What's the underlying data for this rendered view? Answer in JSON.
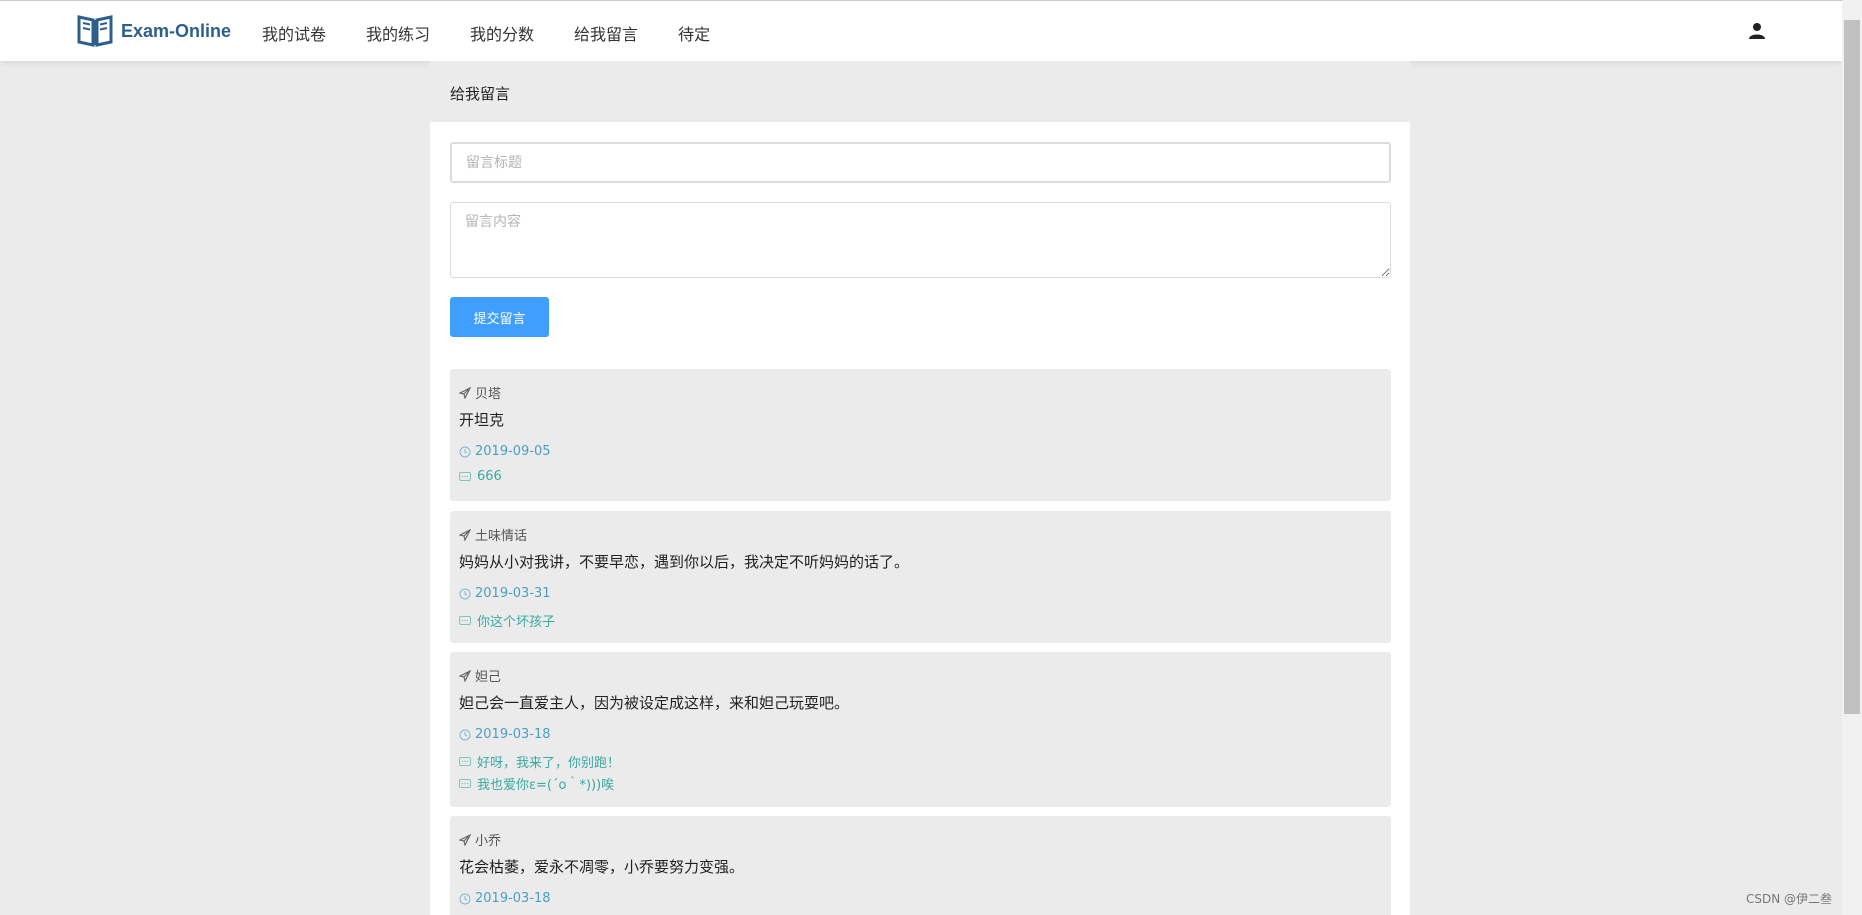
{
  "app": {
    "brand": "Exam-Online"
  },
  "nav": {
    "items": [
      "我的试卷",
      "我的练习",
      "我的分数",
      "给我留言",
      "待定"
    ]
  },
  "page": {
    "title": "给我留言"
  },
  "form": {
    "title_placeholder": "留言标题",
    "content_placeholder": "留言内容",
    "submit_label": "提交留言"
  },
  "messages": [
    {
      "author": "贝塔",
      "content": "开坦克",
      "date": "2019-09-05",
      "replies": [
        "666"
      ]
    },
    {
      "author": "土味情话",
      "content": "妈妈从小对我讲，不要早恋，遇到你以后，我决定不听妈妈的话了。",
      "date": "2019-03-31",
      "replies": [
        "你这个坏孩子"
      ]
    },
    {
      "author": "妲己",
      "content": "妲己会一直爱主人，因为被设定成这样，来和妲己玩耍吧。",
      "date": "2019-03-18",
      "replies": [
        "好呀，我来了，你别跑！",
        "我也爱你ε=(´ο｀*)))唉"
      ]
    },
    {
      "author": "小乔",
      "content": "花会枯萎，爱永不凋零，小乔要努力变强。",
      "date": "2019-03-18",
      "replies": []
    }
  ],
  "watermark": "CSDN @伊二叁",
  "colors": {
    "brand": "#2c5f8c",
    "primary_button": "#409eff",
    "date": "#4a9fc6",
    "reply": "#3aa9a3"
  }
}
